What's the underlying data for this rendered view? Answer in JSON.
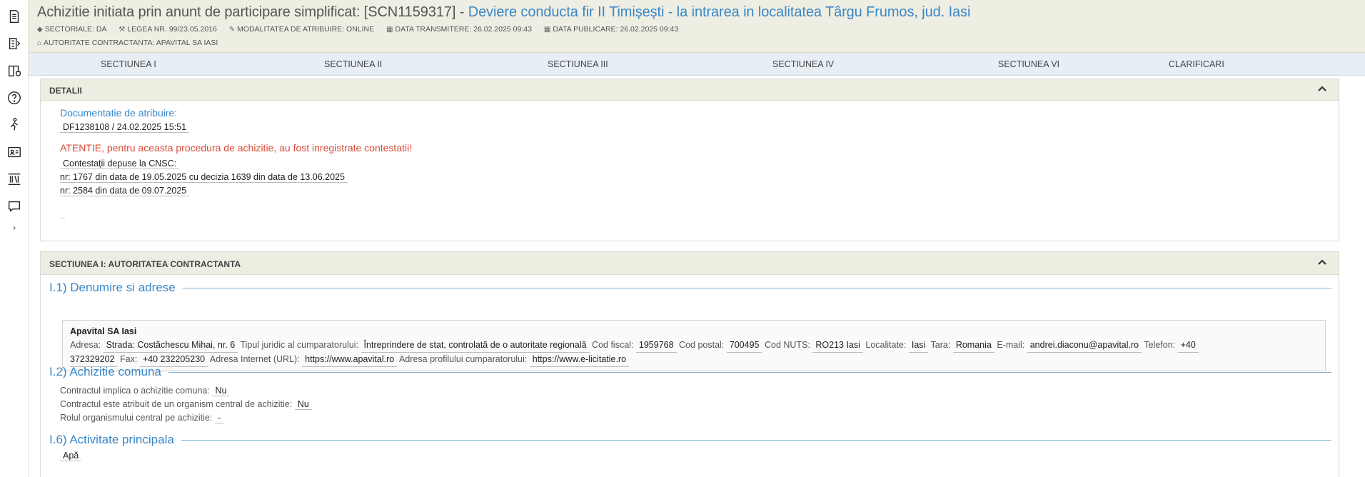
{
  "rail": {
    "icons": [
      "document-icon",
      "list-icon",
      "book-shield-icon",
      "help-icon",
      "person-walk-icon",
      "contact-card-icon",
      "library-icon",
      "chat-icon"
    ],
    "expand": "›"
  },
  "header": {
    "title_prefix": "Achizitie initiata prin anunt de participare simplificat: [SCN1159317] - ",
    "title_link": "Deviere conducta fir II Timișești - la intrarea in localitatea Târgu Frumos, jud. Iasi",
    "meta": {
      "sectoriale": "SECTORIALE: DA",
      "legea": "LEGEA NR. 99/23.05.2016",
      "modalitate": "MODALITATEA DE ATRIBUIRE: ONLINE",
      "transmitere": "DATA TRANSMITERE: 26.02.2025 09:43",
      "publicare": "DATA PUBLICARE: 26.02.2025 09:43",
      "autoritate": "AUTORITATE CONTRACTANTA: APAVITAL SA IASI"
    }
  },
  "tabs": [
    "SECTIUNEA I",
    "SECTIUNEA II",
    "SECTIUNEA III",
    "SECTIUNEA IV",
    "SECTIUNEA VI",
    "CLARIFICARI"
  ],
  "detalii": {
    "title": "DETALII",
    "doc_label": "Documentatie de atribuire:",
    "doc_value": "DF1238108 / 24.02.2025 15:51",
    "warning": "ATENTIE, pentru aceasta procedura de achizitie, au fost inregistrate contestatii!",
    "contest_label": "Contestații depuse la CNSC:",
    "contest_1": "nr: 1767 din data de 19.05.2025 cu decizia 1639 din data de 13.06.2025",
    "contest_2": "nr: 2584 din data de 09.07.2025"
  },
  "sectiunea1": {
    "title": "SECTIUNEA I: AUTORITATEA CONTRACTANTA",
    "s11": "I.1) Denumire si adrese",
    "entity": {
      "name": "Apavital SA Iasi",
      "adresa_lbl": "Adresa:",
      "adresa": "Strada: Costăchescu Mihai, nr. 6",
      "tip_lbl": "Tipul juridic al cumparatorului:",
      "tip": "Întreprindere de stat, controlată de o autoritate regională",
      "cod_fiscal_lbl": "Cod fiscal:",
      "cod_fiscal": "1959768",
      "cod_postal_lbl": "Cod postal:",
      "cod_postal": "700495",
      "nuts_lbl": "Cod NUTS:",
      "nuts": "RO213 Iasi",
      "localitate_lbl": "Localitate:",
      "localitate": "Iasi",
      "tara_lbl": "Tara:",
      "tara": "Romania",
      "email_lbl": "E-mail:",
      "email": "andrei.diaconu@apavital.ro",
      "telefon_lbl": "Telefon:",
      "telefon_1": "+40",
      "telefon_2": "372329202",
      "fax_lbl": "Fax:",
      "fax": "+40 232205230",
      "url_lbl": "Adresa Internet (URL):",
      "url": "https://www.apavital.ro",
      "profil_lbl": "Adresa profilului cumparatorului:",
      "profil": "https://www.e-licitatie.ro"
    },
    "s12": "I.2) Achizitie comuna",
    "comuna_lbl": "Contractul implica o achizitie comuna:",
    "comuna": "Nu",
    "central_lbl": "Contractul este atribuit de un organism central de achizitie:",
    "central": "Nu",
    "rol_lbl": "Rolul organismului central pe achizitie:",
    "rol": "-",
    "s16": "I.6) Activitate principala",
    "activitate": "Apă"
  }
}
